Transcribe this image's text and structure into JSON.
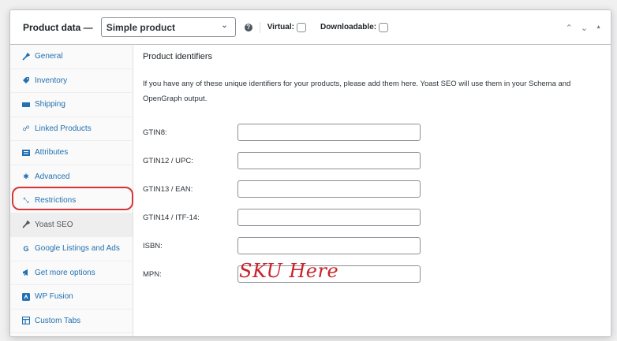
{
  "header": {
    "title": "Product data —",
    "product_type": "Simple product",
    "help": "?",
    "virtual_label": "Virtual:",
    "downloadable_label": "Downloadable:",
    "virtual_checked": false,
    "downloadable_checked": false
  },
  "sidebar": {
    "items": [
      {
        "label": "General",
        "icon": "wrench-icon"
      },
      {
        "label": "Inventory",
        "icon": "tag-icon"
      },
      {
        "label": "Shipping",
        "icon": "truck-icon"
      },
      {
        "label": "Linked Products",
        "icon": "link-icon"
      },
      {
        "label": "Attributes",
        "icon": "list-icon"
      },
      {
        "label": "Advanced",
        "icon": "gear-icon"
      },
      {
        "label": "Restrictions",
        "icon": "arrows-icon"
      },
      {
        "label": "Yoast SEO",
        "icon": "wrench-icon",
        "active": true
      },
      {
        "label": "Google Listings and Ads",
        "icon": "google-icon"
      },
      {
        "label": "Get more options",
        "icon": "megaphone-icon"
      },
      {
        "label": "WP Fusion",
        "icon": "wp-fusion-icon"
      },
      {
        "label": "Custom Tabs",
        "icon": "tabs-icon"
      }
    ]
  },
  "main": {
    "heading": "Product identifiers",
    "description": "If you have any of these unique identifiers for your products, please add them here. Yoast SEO will use them in your Schema and OpenGraph output.",
    "fields": [
      {
        "label": "GTIN8:",
        "value": ""
      },
      {
        "label": "GTIN12 / UPC:",
        "value": ""
      },
      {
        "label": "GTIN13 / EAN:",
        "value": ""
      },
      {
        "label": "GTIN14 / ITF-14:",
        "value": ""
      },
      {
        "label": "ISBN:",
        "value": ""
      },
      {
        "label": "MPN:",
        "value": ""
      }
    ],
    "annotation": "SKU Here"
  },
  "colors": {
    "link": "#2271b1",
    "highlight": "#d63638",
    "annotation": "#c8232c"
  }
}
